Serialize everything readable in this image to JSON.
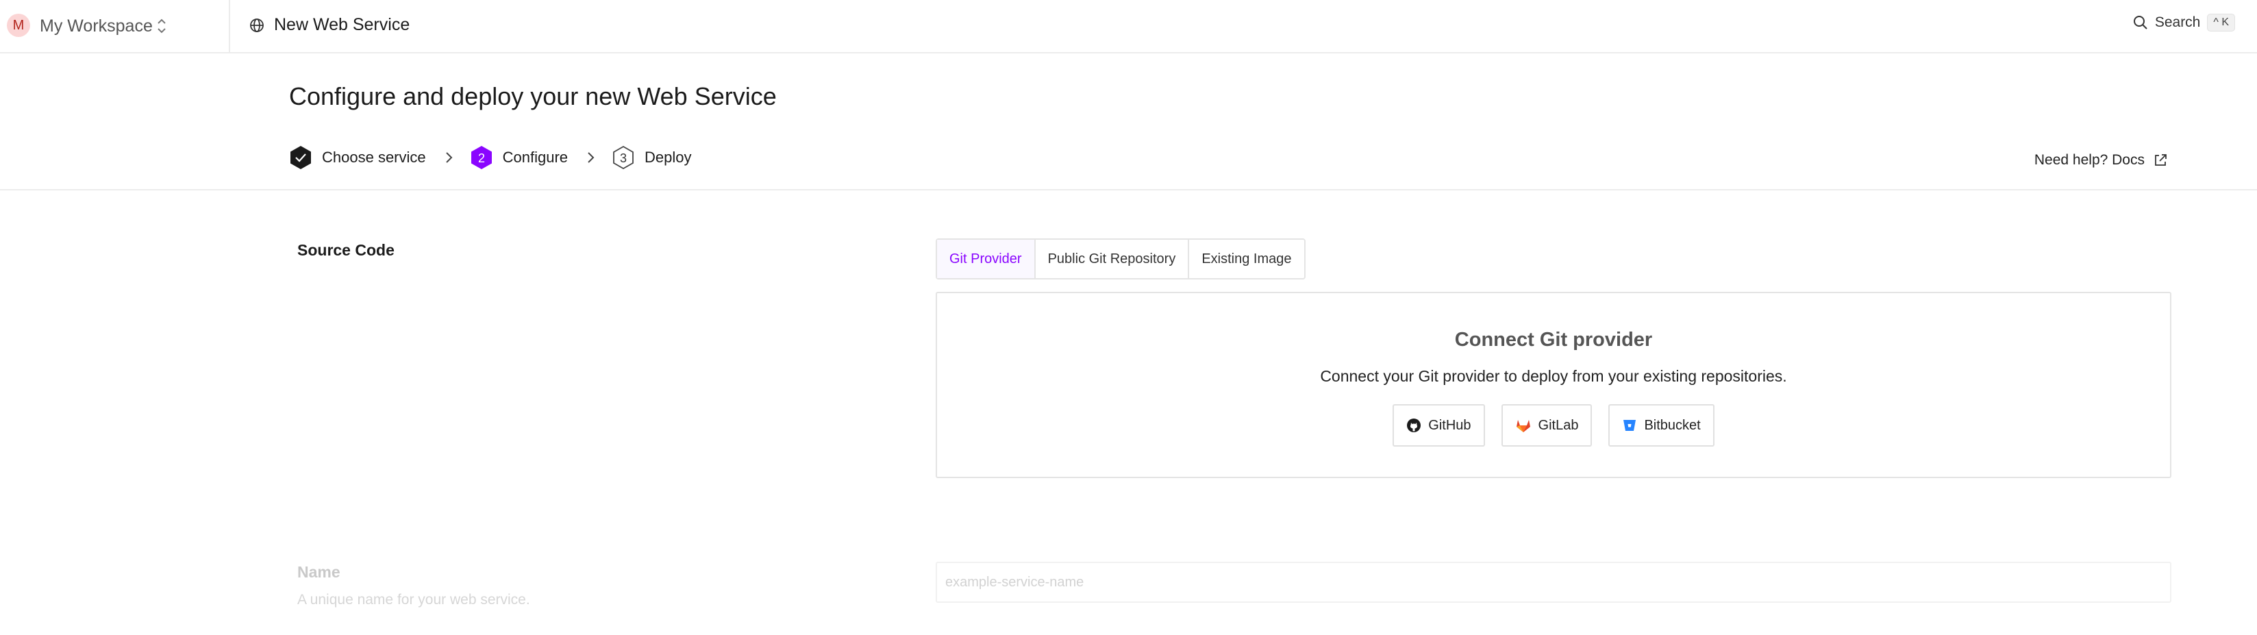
{
  "workspace": {
    "avatar_letter": "M",
    "name": "My Workspace"
  },
  "page": {
    "title": "New Web Service"
  },
  "search": {
    "label": "Search",
    "shortcut": "^ K"
  },
  "heading": "Configure and deploy your new Web Service",
  "steps": [
    {
      "label": "Choose service",
      "marker": "✓",
      "state": "done"
    },
    {
      "label": "Configure",
      "marker": "2",
      "state": "active"
    },
    {
      "label": "Deploy",
      "marker": "3",
      "state": "pending"
    }
  ],
  "help": {
    "label": "Need help? Docs"
  },
  "source_code": {
    "label": "Source Code",
    "tabs": [
      {
        "label": "Git Provider",
        "active": true
      },
      {
        "label": "Public Git Repository",
        "active": false
      },
      {
        "label": "Existing Image",
        "active": false
      }
    ],
    "panel_title": "Connect Git provider",
    "panel_description": "Connect your Git provider to deploy from your existing repositories.",
    "providers": [
      {
        "label": "GitHub",
        "icon": "github-icon"
      },
      {
        "label": "GitLab",
        "icon": "gitlab-icon"
      },
      {
        "label": "Bitbucket",
        "icon": "bitbucket-icon"
      }
    ]
  },
  "name_field": {
    "label": "Name",
    "help": "A unique name for your web service.",
    "placeholder": "example-service-name"
  },
  "colors": {
    "accent": "#8a05ff",
    "done": "#1b1b1b",
    "gitlab": "#e24329",
    "bitbucket": "#2684ff"
  }
}
